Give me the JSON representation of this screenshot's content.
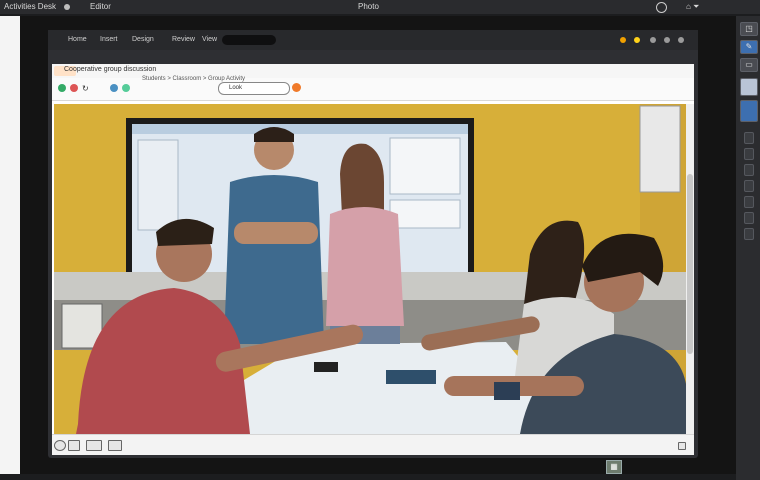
{
  "menubar": {
    "left_label": "Activities Desk",
    "app_label": "Editor",
    "center_label": "Photo"
  },
  "window": {
    "toolbar_items": [
      "Home",
      "Insert",
      "Design",
      "Review",
      "View"
    ],
    "tab_title": "Cooperative group discussion",
    "breadcrumb": "Students > Classroom > Group Activity",
    "url_text": "Look",
    "toolbar_colors": {
      "orange": "#f0a000",
      "yellow": "#ffd21a",
      "gray": "#9a9a9a"
    }
  },
  "image": {
    "description_label": "Classroom scene: students discussing around a table in front of a projection screen",
    "wall_color": "#d9b23a",
    "screen_color": "#dfe8f1"
  },
  "right_toolbar": {
    "icons": [
      "layers-icon",
      "pen-icon",
      "shape-icon",
      "image-icon",
      "photo-icon",
      "tool-icon"
    ]
  }
}
